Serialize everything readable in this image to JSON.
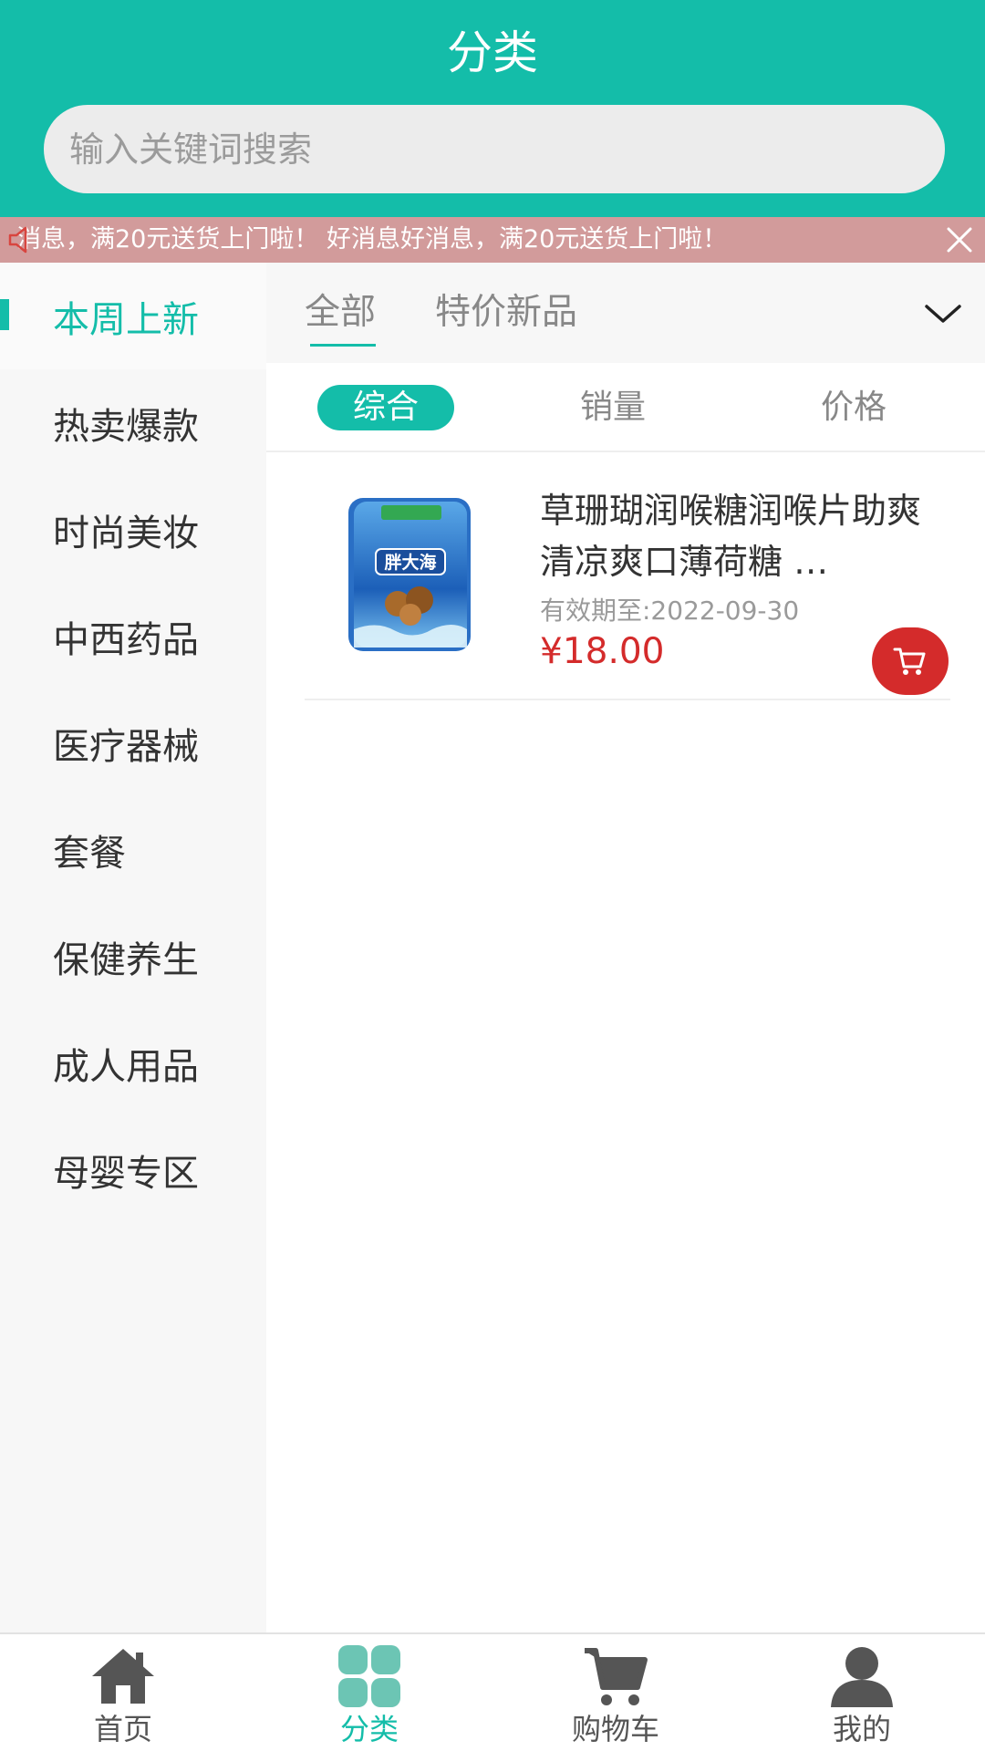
{
  "header": {
    "title": "分类",
    "search_placeholder": "输入关键词搜索"
  },
  "notice": {
    "text": "消息，满20元送货上门啦！   好消息好消息，满20元送货上门啦！"
  },
  "sidebar": {
    "items": [
      {
        "label": "本周上新",
        "active": true
      },
      {
        "label": "热卖爆款"
      },
      {
        "label": "时尚美妆"
      },
      {
        "label": "中西药品"
      },
      {
        "label": "医疗器械"
      },
      {
        "label": "套餐"
      },
      {
        "label": "保健养生"
      },
      {
        "label": "成人用品"
      },
      {
        "label": "母婴专区"
      }
    ]
  },
  "tabs": {
    "items": [
      {
        "label": "全部",
        "active": true
      },
      {
        "label": "特价新品"
      }
    ]
  },
  "sort": {
    "items": [
      {
        "label": "综合",
        "active": true
      },
      {
        "label": "销量"
      },
      {
        "label": "价格"
      }
    ]
  },
  "products": [
    {
      "title": "草珊瑚润喉糖润喉片助爽 清凉爽口薄荷糖 …",
      "image_text": "胖大海",
      "expiry": "有效期至:2022-09-30",
      "price": "¥18.00"
    }
  ],
  "bottom_nav": {
    "items": [
      {
        "label": "首页",
        "icon": "home-icon"
      },
      {
        "label": "分类",
        "icon": "category-icon",
        "active": true
      },
      {
        "label": "购物车",
        "icon": "cart-icon"
      },
      {
        "label": "我的",
        "icon": "user-icon"
      }
    ]
  },
  "colors": {
    "accent": "#14bda9",
    "notice_bg": "#d29b9b",
    "price": "#d42b2b"
  }
}
